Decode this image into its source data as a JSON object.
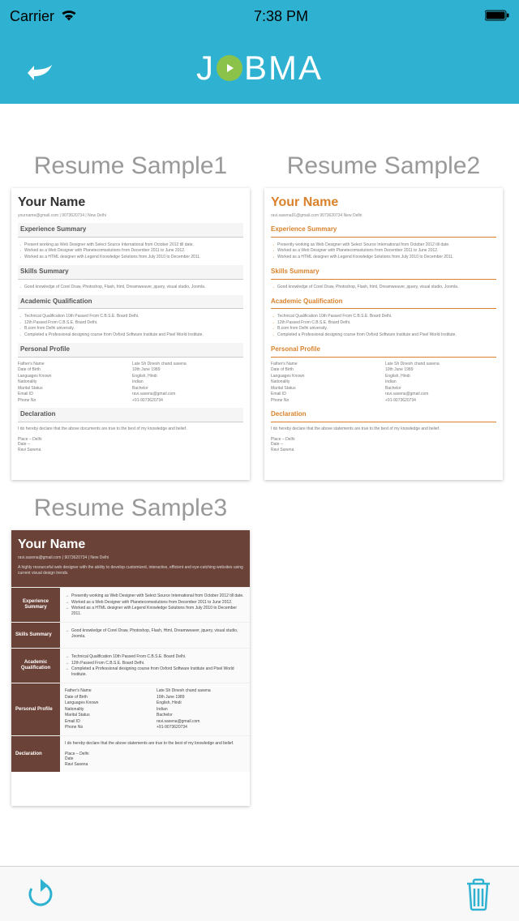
{
  "status": {
    "carrier": "Carrier",
    "time": "7:38 PM"
  },
  "logo": {
    "pre": "J",
    "post": "BMA"
  },
  "cards": [
    {
      "title": "Resume Sample1",
      "name": "Your Name",
      "contact": "yourname@gmail.com  |  9073620734  |  New Delhi",
      "sections": {
        "exp_h": "Experience Summary",
        "exp_b1": "Present working as Web Designer with Select Source International from October 2012 till date.",
        "exp_b2": "Worked as a Web Designer with Planetecomsolutions from December 2011 to June 2012.",
        "exp_b3": "Worked as a HTML designer with Legend Knowledge Solutions from July 2010 to December 2011.",
        "skills_h": "Skills Summary",
        "skills_b1": "Good knowledge of Corel Draw, Photoshop, Flash, html, Dreamweaver, jquery, visual studio, Joomla.",
        "acad_h": "Academic Qualification",
        "acad_b1": "Technical Qualification 10th Passed From C.B.S.E. Board Delhi.",
        "acad_b2": "12th Passed From C.B.S.E. Board Delhi.",
        "acad_b3": "B.com from Delhi university.",
        "acad_b4": "Completed a Professional designing course from Oxford Software Institute and Pixel World Institute.",
        "prof_h": "Personal Profile",
        "p1": "Father's Name",
        "v1": "Late Sh Dinesh chand saxena",
        "p2": "Date of Birth",
        "v2": "10th June 1989",
        "p3": "Languages Known",
        "v3": "English, Hindi",
        "p4": "Nationality",
        "v4": "Indian",
        "p5": "Marital Status",
        "v5": "Bachelor",
        "p6": "Email ID",
        "v6": "ravi.saxena@gmail.com",
        "p7": "Phone No",
        "v7": "+91-9073620734",
        "decl_h": "Declaration",
        "decl_b": "I do hereby declare that the above documents are true to the best of my knowledge and belief.",
        "decl_f1": "Place – Delhi",
        "decl_f2": "Date –",
        "decl_f3": "Ravi Saxena"
      }
    },
    {
      "title": "Resume Sample2",
      "name": "Your Name",
      "contact": "ravi.saxena91@gmail.com   9073620734   New Delhi",
      "sections": {
        "exp_h": "Experience Summary",
        "exp_b1": "Presently working as Web Designer with Select Source International from October 2012 till date.",
        "exp_b2": "Worked as a Web Designer with Planetecomsolutions from December 2011 to June 2012.",
        "exp_b3": "Worked as a HTML designer with Legend Knowledge Solutions from July 2010 to December 2011.",
        "skills_h": "Skills Summary",
        "skills_b1": "Good knowledge of Corel Draw, Photoshop, Flash, html, Dreamweaver, jquery, visual studio, Joomla.",
        "acad_h": "Academic Qualification",
        "acad_b1": "Technical Qualification 10th Passed From C.B.S.E. Board Delhi.",
        "acad_b2": "12th Passed From C.B.S.E. Board Delhi.",
        "acad_b3": "B.com from Delhi university.",
        "acad_b4": "Completed a Professional designing course from Oxford Software Institute and Pixel World Institute.",
        "prof_h": "Personal Profile",
        "p1": "Father's Name",
        "v1": "Late Sh Dinesh chand saxena",
        "p2": "Date of Birth",
        "v2": "10th June 1989",
        "p3": "Languages Known",
        "v3": "English, Hindi",
        "p4": "Nationality",
        "v4": "Indian",
        "p5": "Marital Status",
        "v5": "Bachelor",
        "p6": "Email ID",
        "v6": "ravi.saxena@gmail.com",
        "p7": "Phone No",
        "v7": "+91-9073620734",
        "decl_h": "Declaration",
        "decl_b": "I do hereby declare that the above statements are true to the best of my knowledge and belief.",
        "decl_f1": "Place – Delhi",
        "decl_f2": "Date –",
        "decl_f3": "Ravi Saxena"
      }
    },
    {
      "title": "Resume Sample3",
      "name": "Your Name",
      "contact": "ravi.saxena@gmail.com | 9073620734 | New Delhi",
      "summary": "A highly resourceful web designer with the ability to develop customized, interactive, efficient and eye-catching websites using current visual design trends.",
      "sections": {
        "exp_h": "Experience Summary",
        "exp_b1": "Presently working as Web Designer with Select Source International from October 2012 till date.",
        "exp_b2": "Worked as a Web Designer with Planetecomsolutions from December 2011 to June 2012.",
        "exp_b3": "Worked as a HTML designer with Legend Knowledge Solutions from July 2010 to December 2011.",
        "skills_h": "Skills Summary",
        "skills_b1": "Good knowledge of Corel Draw, Photoshop, Flash, Html, Dreamweaver, jquery, visual studio, Joomla.",
        "acad_h": "Academic Qualification",
        "acad_b1": "Technical Qualification 10th Passed From C.B.S.E. Board Delhi.",
        "acad_b2": "12th Passed From C.B.S.E. Board Delhi.",
        "acad_b3": "Completed a Professional designing course from Oxford Software Institute and Pixel World Institute.",
        "prof_h": "Personal Profile",
        "p1": "Father's Name",
        "v1": "Late Sh Dinesh chand saxena",
        "p2": "Date of Birth",
        "v2": "10th June 1989",
        "p3": "Languages Known",
        "v3": "English, Hindi",
        "p4": "Nationality",
        "v4": "Indian",
        "p5": "Marital Status",
        "v5": "Bachelor",
        "p6": "Email ID",
        "v6": "ravi.saxena@gmail.com",
        "p7": "Phone No",
        "v7": "+91-9073620734",
        "decl_h": "Declaration",
        "decl_b": "I do hereby declare that the above statements are true to the best of my knowledge and belief.",
        "decl_f1": "Place – Delhi",
        "decl_f2": "Date",
        "decl_f3": "Ravi Saxena"
      }
    }
  ]
}
